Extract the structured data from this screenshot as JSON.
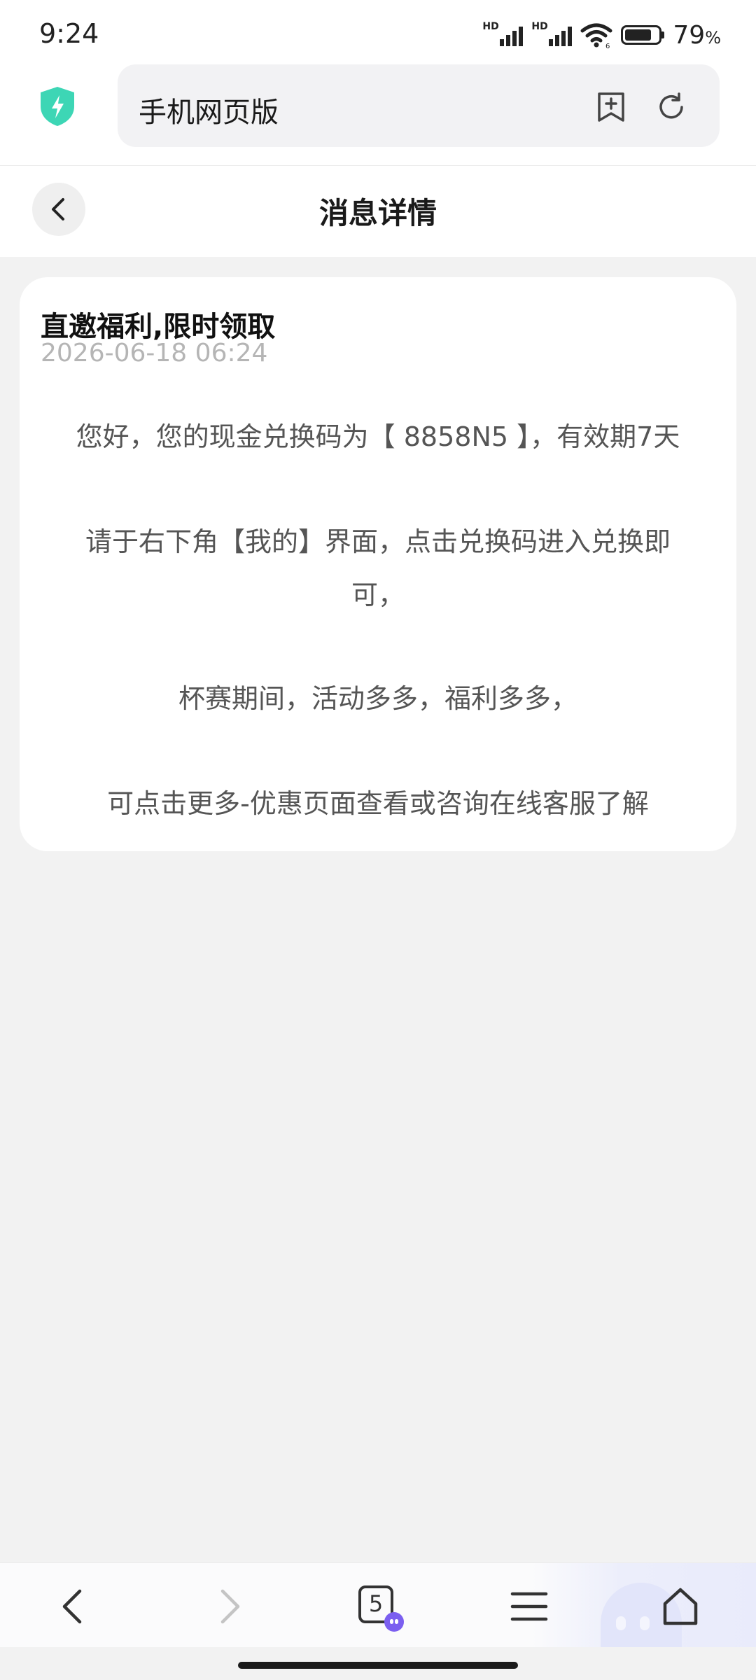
{
  "status_bar": {
    "time": "9:24",
    "network_badge_1": "HD",
    "network_badge_2": "HD",
    "battery_percent": "79",
    "battery_unit": "%",
    "battery_level": 0.79
  },
  "browser": {
    "address_text": "手机网页版",
    "shield_color": "#3dd6b5",
    "icons": [
      "security-shield-icon",
      "bookmark-add-icon",
      "refresh-icon"
    ]
  },
  "page": {
    "title": "消息详情",
    "back_icon": "chevron-left-icon"
  },
  "message": {
    "title": "直邀福利,限时领取",
    "date": "2026-06-18 06:24",
    "lines": [
      "您好，您的现金兑换码为【 8858N5 】，有效期7天",
      "请于右下角【我的】界面，点击兑换码进入兑换即",
      "可，",
      "杯赛期间，活动多多，福利多多，",
      "可点击更多-优惠页面查看或咨询在线客服了解"
    ]
  },
  "bottom_nav": {
    "tab_count": "5",
    "badge_color": "#7b5ff0",
    "icons": [
      "back-icon",
      "forward-icon",
      "tabs-icon",
      "menu-icon",
      "home-icon"
    ]
  }
}
